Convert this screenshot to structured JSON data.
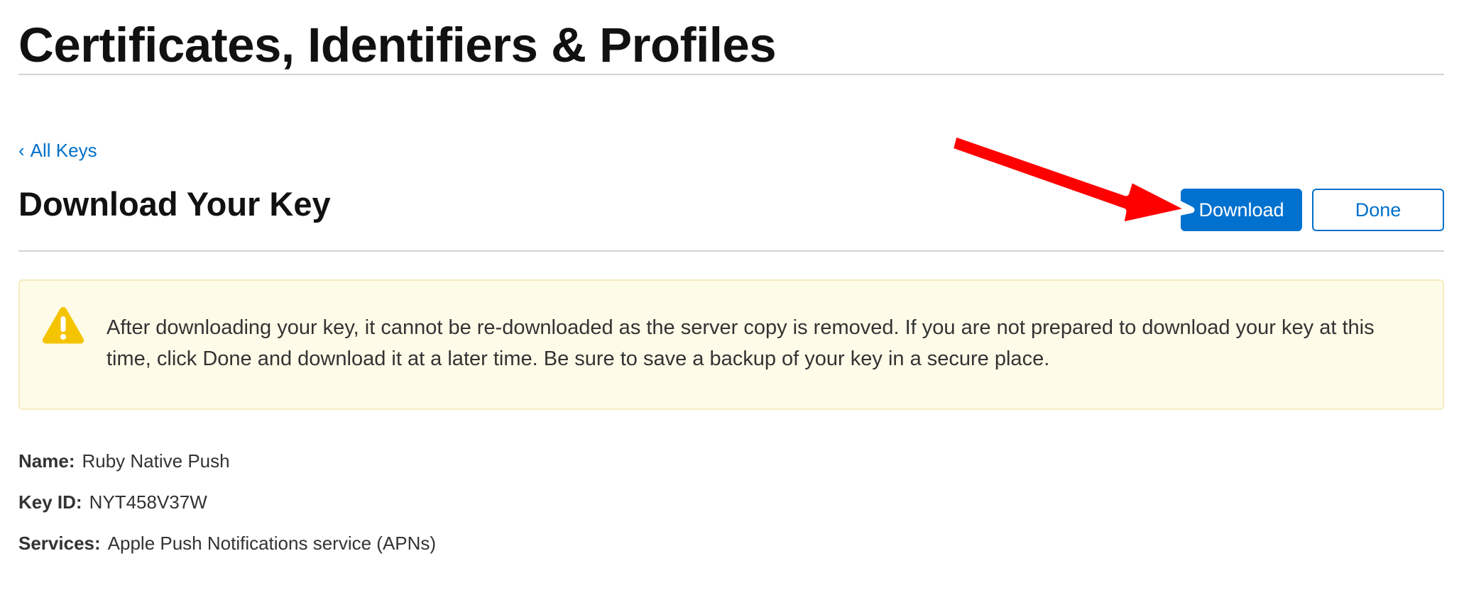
{
  "header": {
    "title": "Certificates, Identifiers & Profiles"
  },
  "nav": {
    "back_chevron": "‹",
    "back_label": "All Keys"
  },
  "section": {
    "title": "Download Your Key"
  },
  "actions": {
    "download_label": "Download",
    "done_label": "Done"
  },
  "alert": {
    "icon": "warning-triangle-icon",
    "message": "After downloading your key, it cannot be re-downloaded as the server copy is removed. If you are not prepared to download your key at this time, click Done and download it at a later time. Be sure to save a backup of your key in a secure place."
  },
  "details": {
    "name_label": "Name:",
    "name_value": "Ruby Native Push",
    "key_id_label": "Key ID:",
    "key_id_value": "NYT458V37W",
    "services_label": "Services:",
    "services_value": "Apple Push Notifications service (APNs)"
  },
  "colors": {
    "accent": "#0071ce",
    "alert_background": "#fefbe8",
    "alert_border": "#f6ecbf",
    "warning_icon": "#f5c400",
    "annotation_arrow": "#ff0000"
  }
}
